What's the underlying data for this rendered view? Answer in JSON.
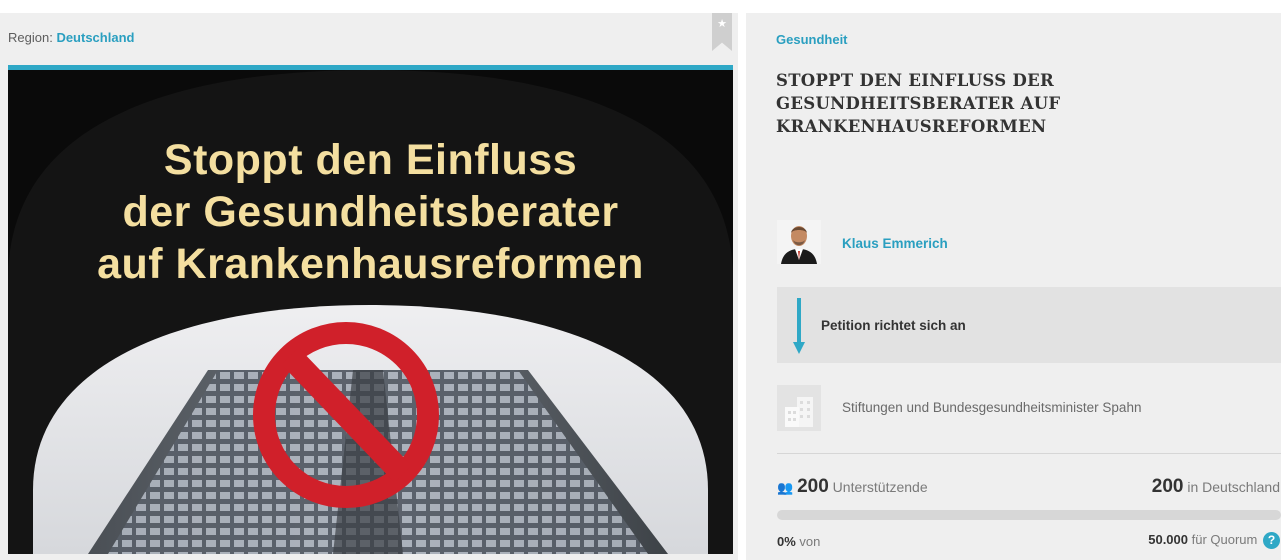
{
  "region": {
    "label": "Region:",
    "value": "Deutschland"
  },
  "hero": {
    "title_lines": [
      "Stoppt den Einfluss",
      "der Gesundheitsberater",
      "auf Krankenhausreformen"
    ]
  },
  "category": "Gesundheit",
  "petition_title": "STOPPT DEN EINFLUSS DER GESUNDHEITSBERATER AUF KRANKENHAUSREFORMEN",
  "author": {
    "name": "Klaus Emmerich"
  },
  "addressed": {
    "label": "Petition richtet sich an",
    "recipient": "Stiftungen und Bundesgesundheitsminister Spahn"
  },
  "stats": {
    "supporters_count": "200",
    "supporters_label": "Unterstützende",
    "region_count": "200",
    "region_label": "in Deutschland",
    "progress_percent": 0,
    "percent_text": "0%",
    "percent_suffix": "von",
    "quorum_value": "50.000",
    "quorum_label": "für Quorum",
    "help_glyph": "?"
  },
  "colors": {
    "accent": "#2fa8c6",
    "hero_text": "#f4dfa0",
    "prohibition_red": "#d0202a"
  },
  "icons": {
    "bookmark": "star-bookmark-icon",
    "supporters": "people-icon",
    "recipient": "building-icon",
    "arrow": "arrow-down-icon",
    "help": "help-icon"
  }
}
